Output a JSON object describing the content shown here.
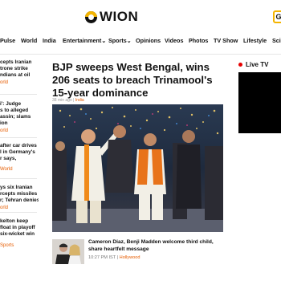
{
  "brand": {
    "name": "WION",
    "header_button": "G"
  },
  "nav": [
    {
      "label": "Pulse"
    },
    {
      "label": "World"
    },
    {
      "label": "India"
    },
    {
      "label": "Entertainment"
    },
    {
      "label": "Sports"
    },
    {
      "label": "Opinions"
    },
    {
      "label": "Videos"
    },
    {
      "label": "Photos"
    },
    {
      "label": "TV Show"
    },
    {
      "label": "Lifestyle"
    },
    {
      "label": "Scie"
    }
  ],
  "left_rail": [
    {
      "lines": [
        "cepts Iranian",
        "trone strike",
        "ndians at oil"
      ],
      "tag": "orld"
    },
    {
      "lines": [
        "i': Judge",
        "s to alleged",
        "assin; slams",
        "ion"
      ],
      "tag": "orld"
    },
    {
      "lines": [
        "after car drives",
        "l in Germany's",
        "r says,"
      ],
      "tag": "World"
    },
    {
      "lines": [
        "ys six Iranian",
        "rcepts missiles",
        "r; Tehran denies"
      ],
      "tag": "orld"
    },
    {
      "lines": [
        "kelton keep",
        "float in playoff",
        "six-wicket win"
      ],
      "tag": "Sports"
    }
  ],
  "article": {
    "headline": "BJP sweeps West Bengal, wins 206 seats to breach Trinamool's 15-year dominance",
    "time_ago": "38 min ago",
    "category": "India"
  },
  "secondary": {
    "title": "Cameron Diaz, Benji Madden welcome third child, share heartfelt message",
    "time": "10:27 PM IST",
    "category": "Hollywood"
  },
  "live_tv": {
    "label": "Live TV"
  },
  "colors": {
    "accent": "#e65c00",
    "logo_yellow": "#f4b400",
    "live_red": "#e60000"
  }
}
